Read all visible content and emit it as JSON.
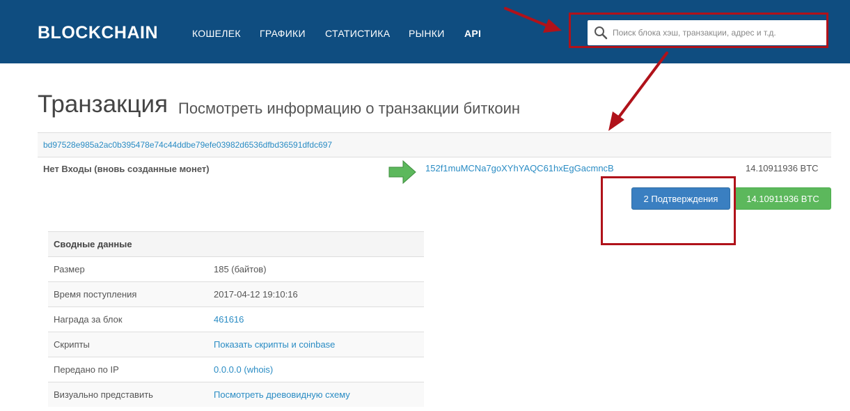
{
  "header": {
    "brand": "BLOCKCHAIN",
    "nav": [
      "КОШЕЛЕК",
      "ГРАФИКИ",
      "СТАТИСТИКА",
      "РЫНКИ",
      "API"
    ],
    "search_placeholder": "Поиск блока хэш, транзакции, адрес и т.д."
  },
  "page": {
    "title": "Транзакция",
    "subtitle": "Посмотреть информацию о транзакции биткоин"
  },
  "transaction": {
    "hash": "bd97528e985a2ac0b395478e74c44ddbe79efe03982d6536dfbd36591dfdc697",
    "inputs_label": "Нет Входы (вновь созданные монет)",
    "output_address": "152f1muMCNa7goXYhYAQC61hxEgGacmncB",
    "output_amount": "14.10911936 BTC",
    "confirmations_label": "2 Подтверждения",
    "total_label": "14.10911936 BTC"
  },
  "summary": {
    "heading": "Сводные данные",
    "rows": [
      {
        "label": "Размер",
        "value": "185 (байтов)"
      },
      {
        "label": "Время поступления",
        "value": "2017-04-12 19:10:16"
      },
      {
        "label": "Награда за блок",
        "value": "461616"
      },
      {
        "label": "Скрипты",
        "value": "Показать скрипты и coinbase"
      },
      {
        "label": "Передано по IP",
        "value": "0.0.0.0 (whois)"
      },
      {
        "label": "Визуально представить",
        "value": "Посмотреть древовидную схему"
      }
    ]
  },
  "colors": {
    "navbar": "#0f4d80",
    "annotation": "#b0121a",
    "link": "#2a8cc4",
    "confirm_button": "#3a7fc1",
    "total_button": "#5cb85c"
  }
}
